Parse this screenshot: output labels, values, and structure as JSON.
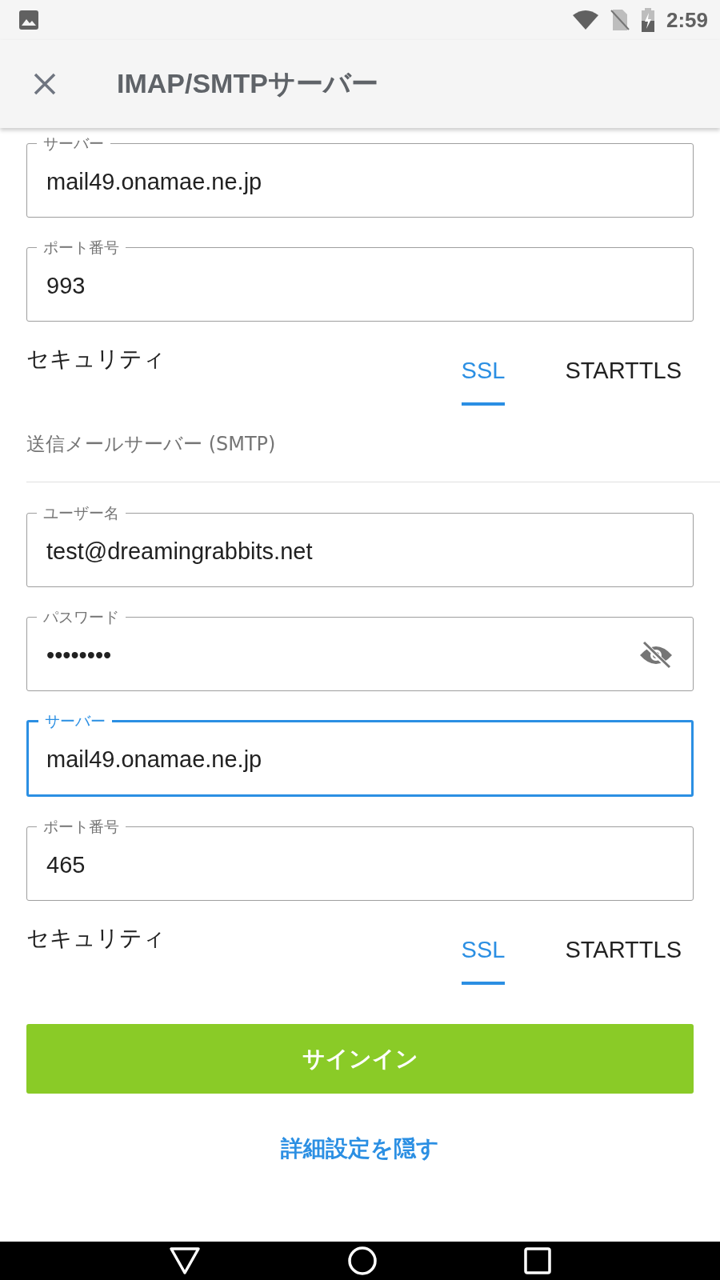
{
  "status_bar": {
    "time": "2:59"
  },
  "app_bar": {
    "title": "IMAP/SMTPサーバー"
  },
  "incoming": {
    "fields": [
      {
        "kind": "text",
        "label": "サーバー",
        "value": "mail49.onamae.ne.jp",
        "focused": false
      },
      {
        "kind": "text",
        "label": "ポート番号",
        "value": "993",
        "focused": false
      }
    ],
    "security": {
      "label": "セキュリティ",
      "options": [
        {
          "label": "SSL",
          "selected": true
        },
        {
          "label": "STARTTLS",
          "selected": false
        }
      ]
    }
  },
  "outgoing": {
    "header": "送信メールサーバー (SMTP)",
    "fields": [
      {
        "kind": "text",
        "label": "ユーザー名",
        "value": "test@dreamingrabbits.net",
        "focused": false
      },
      {
        "kind": "password",
        "label": "パスワード",
        "value": "••••••••",
        "focused": false
      },
      {
        "kind": "text",
        "label": "サーバー",
        "value": "mail49.onamae.ne.jp",
        "focused": true
      },
      {
        "kind": "text",
        "label": "ポート番号",
        "value": "465",
        "focused": false
      }
    ],
    "security": {
      "label": "セキュリティ",
      "options": [
        {
          "label": "SSL",
          "selected": true
        },
        {
          "label": "STARTTLS",
          "selected": false
        }
      ]
    }
  },
  "sign_in_button": "サインイン",
  "toggle_link": "詳細設定を隠す"
}
